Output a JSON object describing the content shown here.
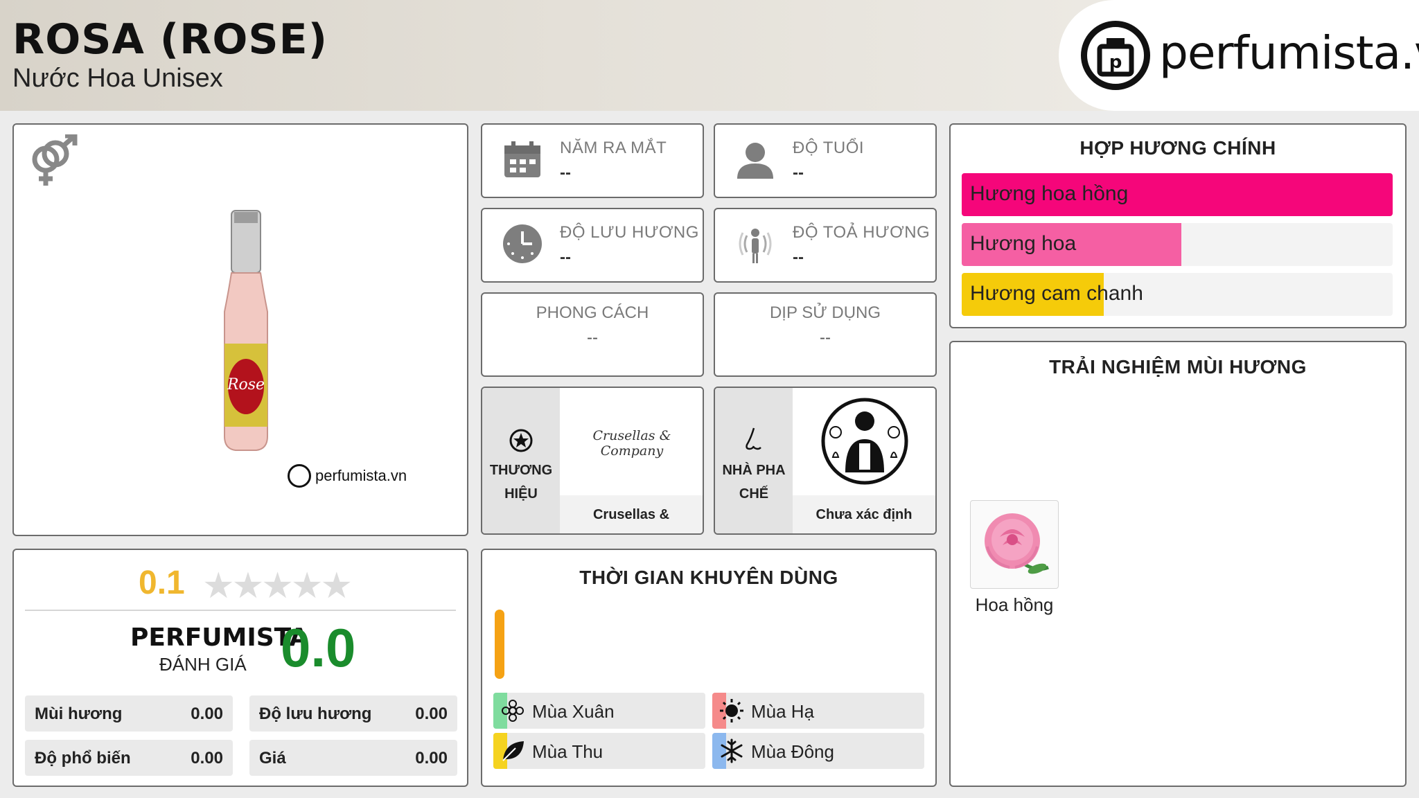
{
  "header": {
    "title": "ROSA (ROSE)",
    "subtitle": "Nước Hoa Unisex",
    "logo_text": "perfumista.vn"
  },
  "product": {
    "gender_icon": "unisex-icon",
    "watermark": "perfumista.vn"
  },
  "info": {
    "release_year": {
      "label": "NĂM RA MẮT",
      "value": "--",
      "icon": "calendar-icon"
    },
    "age": {
      "label": "ĐỘ TUỔI",
      "value": "--",
      "icon": "person-icon"
    },
    "longevity": {
      "label": "ĐỘ LƯU HƯƠNG",
      "value": "--",
      "icon": "clock-icon"
    },
    "sillage": {
      "label": "ĐỘ TOẢ HƯƠNG",
      "value": "--",
      "icon": "sillage-icon"
    },
    "style": {
      "label": "PHONG CÁCH",
      "value": "--"
    },
    "occasion": {
      "label": "DỊP SỬ DỤNG",
      "value": "--"
    },
    "brand": {
      "label": "THƯƠNG HIỆU",
      "value": "Crusellas & Company",
      "logo_text": "Crusellas & Company",
      "icon": "star-badge-icon"
    },
    "perfumer": {
      "label": "NHÀ PHA CHẾ",
      "value": "Chưa xác định",
      "icon": "nose-icon"
    }
  },
  "accords": {
    "title": "HỢP HƯƠNG CHÍNH",
    "items": [
      {
        "label": "Hương hoa hồng",
        "value": 1.0,
        "color": "#f5067a"
      },
      {
        "label": "Hương hoa",
        "value": 0.51,
        "color": "#f55fa3"
      },
      {
        "label": "Hương cam chanh",
        "value": 0.33,
        "color": "#f5cb0a"
      }
    ]
  },
  "rating": {
    "user_score": "0.1",
    "stars": "★★★★★",
    "brand_label": "PERFUMISTA",
    "brand_sub": "ĐÁNH GIÁ",
    "score": "0.0",
    "metrics": [
      {
        "label": "Mùi hương",
        "value": "0.00"
      },
      {
        "label": "Độ lưu hương",
        "value": "0.00"
      },
      {
        "label": "Độ phổ biến",
        "value": "0.00"
      },
      {
        "label": "Giá",
        "value": "0.00"
      }
    ]
  },
  "seasons": {
    "title": "THỜI GIAN KHUYÊN DÙNG",
    "items": [
      {
        "label": "Mùa Xuân",
        "color": "#7fdc9e",
        "icon": "flower-icon"
      },
      {
        "label": "Mùa Hạ",
        "color": "#f58a8a",
        "icon": "sun-icon"
      },
      {
        "label": "Mùa Thu",
        "color": "#f5d320",
        "icon": "leaf-icon"
      },
      {
        "label": "Mùa Đông",
        "color": "#8cb8ee",
        "icon": "snowflake-icon"
      }
    ],
    "indicator_color": "#f5a214"
  },
  "experience": {
    "title": "TRẢI NGHIỆM MÙI HƯƠNG",
    "notes": [
      {
        "label": "Hoa hồng",
        "icon": "rose-icon"
      }
    ]
  }
}
